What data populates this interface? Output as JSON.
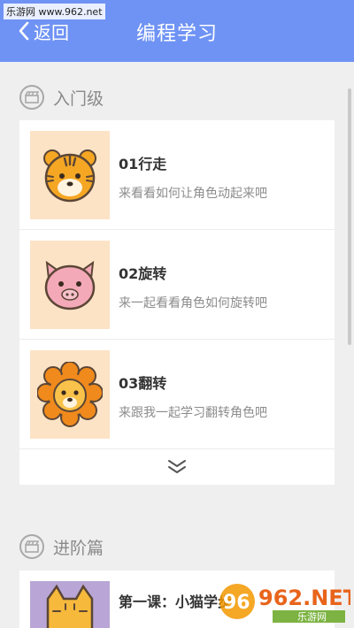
{
  "watermark_top": "乐游网 www.962.net",
  "header": {
    "back_label": "返回",
    "title": "编程学习"
  },
  "section_beginner": {
    "title": "入门级",
    "items": [
      {
        "title": "01行走",
        "desc": "来看看如何让角色动起来吧",
        "icon": "tiger-icon"
      },
      {
        "title": "02旋转",
        "desc": "来一起看看角色如何旋转吧",
        "icon": "pig-icon"
      },
      {
        "title": "03翻转",
        "desc": "来跟我一起学习翻转角色吧",
        "icon": "lion-icon"
      }
    ],
    "more_icon": "double-chevron-down-icon"
  },
  "section_advanced": {
    "title": "进阶篇",
    "items": [
      {
        "title": "第一课：小猫学步",
        "icon": "cat-icon"
      }
    ]
  },
  "logo": {
    "text": "962.NET",
    "subtext": "乐游网"
  },
  "colors": {
    "header": "#6f93f4",
    "thumb_bg": "#fde3c6",
    "page_bg": "#efeff0"
  }
}
